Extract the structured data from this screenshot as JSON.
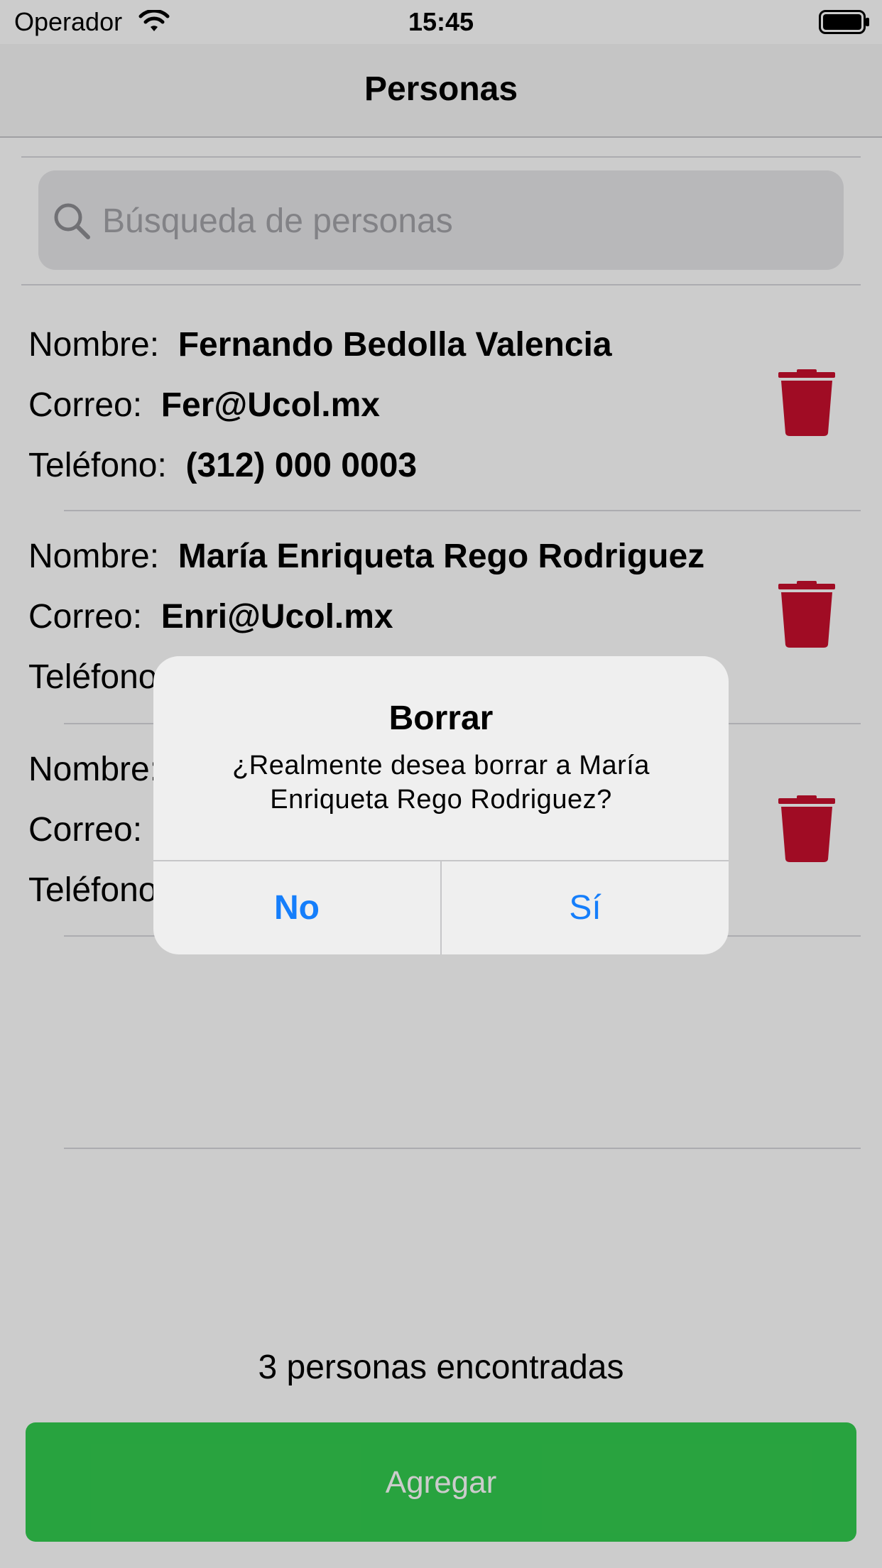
{
  "status_bar": {
    "carrier": "Operador",
    "time": "15:45"
  },
  "nav": {
    "title": "Personas"
  },
  "search": {
    "placeholder": "Búsqueda de personas"
  },
  "labels": {
    "name": "Nombre:",
    "email": "Correo:",
    "phone": "Teléfono:"
  },
  "people": [
    {
      "name": "Fernando Bedolla Valencia",
      "email": "Fer@Ucol.mx",
      "phone": "(312) 000 0003"
    },
    {
      "name": "María Enriqueta Rego Rodriguez",
      "email": "Enri@Ucol.mx",
      "phone": ""
    },
    {
      "name": "",
      "email": "",
      "phone": ""
    }
  ],
  "footer": {
    "count_text": "3 personas encontradas",
    "add_label": "Agregar"
  },
  "alert": {
    "title": "Borrar",
    "message": "¿Realmente desea borrar a María Enriqueta Rego Rodriguez?",
    "no_label": "No",
    "yes_label": "Sí"
  },
  "colors": {
    "accent": "#157efb",
    "delete": "#c8102e",
    "add_button": "#33cc4f"
  },
  "icons": [
    "wifi-icon",
    "battery-icon",
    "search-icon",
    "trash-icon"
  ]
}
